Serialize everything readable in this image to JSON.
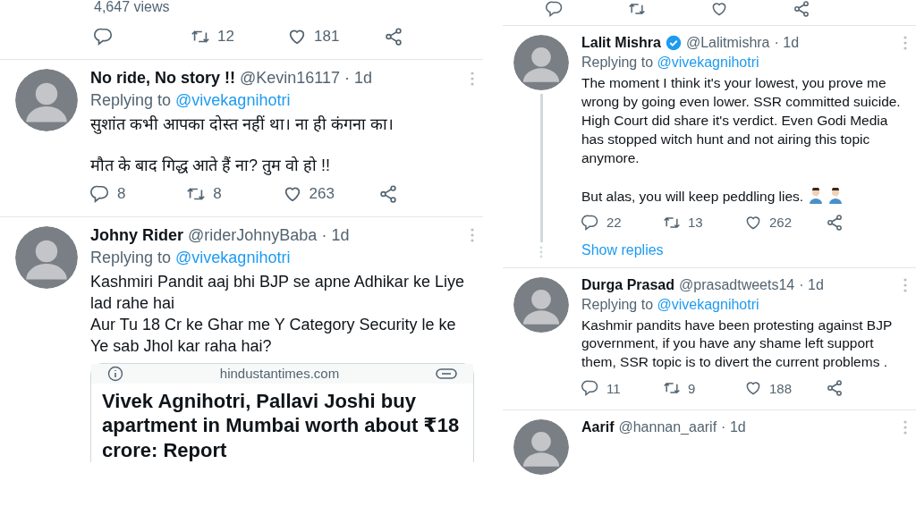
{
  "left_column": {
    "views": "4,647 views",
    "actions": [
      {
        "kind": "reply"
      },
      {
        "kind": "retweet",
        "count": "12"
      },
      {
        "kind": "like",
        "count": "181"
      },
      {
        "kind": "share"
      }
    ],
    "tweets": [
      {
        "name": "No ride, No story !!",
        "verified": false,
        "handle": "@Kevin16117",
        "time": "· 1d",
        "replying_label": "Replying to",
        "replying_to": "@vivekagnihotri",
        "body": [
          "सुशांत कभी आपका दोस्त नहीं था। ना ही कंगना का।",
          "मौत के बाद गिद्ध आते हैं ना? तुम वो हो !!"
        ],
        "actions": [
          {
            "kind": "reply",
            "count": "8"
          },
          {
            "kind": "retweet",
            "count": "8"
          },
          {
            "kind": "like",
            "count": "263"
          },
          {
            "kind": "share"
          }
        ]
      },
      {
        "name": "Johny Rider",
        "verified": false,
        "handle": "@riderJohnyBaba",
        "time": "· 1d",
        "replying_label": "Replying to",
        "replying_to": "@vivekagnihotri",
        "body": [
          "Kashmiri Pandit aaj bhi BJP se apne Adhikar ke Liye lad rahe hai\nAur Tu 18 Cr ke Ghar me Y Category Security le ke Ye sab Jhol kar raha hai?"
        ],
        "link_card": {
          "domain": "hindustantimes.com",
          "headline": "Vivek Agnihotri, Pallavi Joshi buy apartment in Mumbai worth about ₹18 crore: Report"
        }
      }
    ]
  },
  "right_column": {
    "actions": [
      {
        "kind": "reply"
      },
      {
        "kind": "retweet"
      },
      {
        "kind": "like"
      },
      {
        "kind": "share"
      }
    ],
    "tweets": [
      {
        "name": "Lalit Mishra",
        "verified": true,
        "handle": "@Lalitmishra",
        "time": "· 1d",
        "replying_label": "Replying to",
        "replying_to": "@vivekagnihotri",
        "thread_line": true,
        "body": [
          "The moment I think it's your lowest, you prove me wrong by going even lower. SSR committed suicide. High Court did share it's verdict. Even Godi Media has stopped witch hunt and not airing this topic anymore.",
          "But alas, you will keep peddling lies."
        ],
        "trailing_emojis": [
          {
            "kind": "facepalm"
          },
          {
            "kind": "facepalm"
          }
        ],
        "actions": [
          {
            "kind": "reply",
            "count": "22"
          },
          {
            "kind": "retweet",
            "count": "13"
          },
          {
            "kind": "like",
            "count": "262"
          },
          {
            "kind": "share"
          }
        ],
        "show_replies": "Show replies"
      },
      {
        "name": "Durga Prasad",
        "verified": false,
        "handle": "@prasadtweets14",
        "time": "· 1d",
        "replying_label": "Replying to",
        "replying_to": "@vivekagnihotri",
        "body": [
          "Kashmir pandits have been protesting against BJP government, if you have any shame left support them, SSR topic is to divert the current problems ."
        ],
        "actions": [
          {
            "kind": "reply",
            "count": "11"
          },
          {
            "kind": "retweet",
            "count": "9"
          },
          {
            "kind": "like",
            "count": "188"
          },
          {
            "kind": "share"
          }
        ]
      },
      {
        "name": "Aarif",
        "verified": false,
        "handle": "@hannan_aarif",
        "time": "· 1d"
      }
    ]
  }
}
